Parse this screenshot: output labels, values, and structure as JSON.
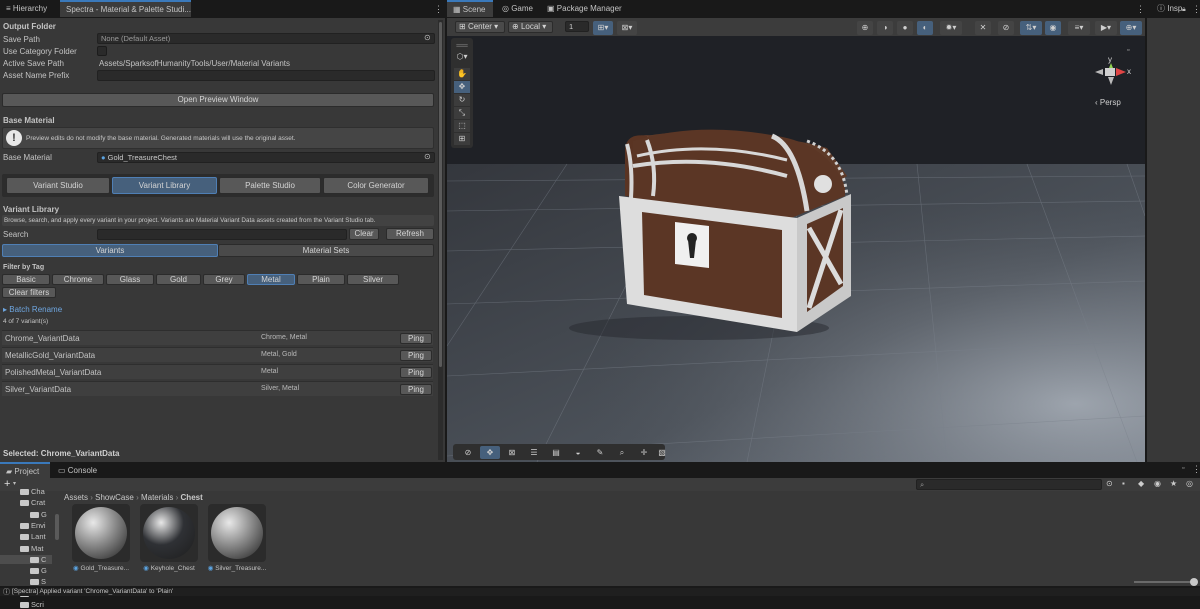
{
  "top_tabs": {
    "hierarchy": "Hierarchy",
    "spectra": "Spectra - Material & Palette Studi...",
    "scene": "Scene",
    "game": "Game",
    "package_manager": "Package Manager",
    "inspector": "Insp"
  },
  "output_folder": {
    "heading": "Output Folder",
    "save_path_label": "Save Path",
    "save_path_value": "None (Default Asset)",
    "use_category_label": "Use Category Folder",
    "active_save_label": "Active Save Path",
    "active_save_value": "Assets/SparksofHumanityTools/User/Material Variants",
    "prefix_label": "Asset Name Prefix",
    "prefix_value": ""
  },
  "open_preview_button": "Open Preview Window",
  "base_material": {
    "heading": "Base Material",
    "info": "Preview edits do not modify the base material. Generated materials will use the original asset.",
    "label": "Base Material",
    "value": "Gold_TreasureChest"
  },
  "studio_tabs": [
    "Variant Studio",
    "Variant Library",
    "Palette Studio",
    "Color Generator"
  ],
  "library": {
    "heading": "Variant Library",
    "description": "Browse, search, and apply every variant in your project. Variants are Material Variant Data assets created from the Variant Studio tab.",
    "search_label": "Search",
    "clear_button": "Clear",
    "refresh_button": "Refresh",
    "subtabs": [
      "Variants",
      "Material Sets"
    ],
    "filter_heading": "Filter by Tag",
    "tags": [
      "Basic",
      "Chrome",
      "Glass",
      "Gold",
      "Grey",
      "Metal",
      "Plain",
      "Silver"
    ],
    "clear_filters": "Clear filters",
    "batch_rename": "Batch Rename",
    "count": "4 of 7 variant(s)",
    "ping_label": "Ping",
    "variants": [
      {
        "name": "Chrome_VariantData",
        "tags": "Chrome, Metal"
      },
      {
        "name": "MetallicGold_VariantData",
        "tags": "Metal, Gold"
      },
      {
        "name": "PolishedMetal_VariantData",
        "tags": "Metal"
      },
      {
        "name": "Silver_VariantData",
        "tags": "Silver, Metal"
      }
    ],
    "selected": "Selected: Chrome_VariantData"
  },
  "scene_toolbar": {
    "pivot": "Center",
    "space": "Local",
    "snap_value": "1"
  },
  "gizmo": {
    "y": "y",
    "x": "x",
    "persp": "‹ Persp"
  },
  "bottom_tabs": {
    "project": "Project",
    "console": "Console"
  },
  "project": {
    "tree": [
      {
        "label": "Cha",
        "indent": 1
      },
      {
        "label": "Crat",
        "indent": 1
      },
      {
        "label": "G",
        "indent": 2
      },
      {
        "label": "Envi",
        "indent": 1
      },
      {
        "label": "Lant",
        "indent": 1
      },
      {
        "label": "Mat",
        "indent": 1
      },
      {
        "label": "C",
        "indent": 2
      },
      {
        "label": "G",
        "indent": 2
      },
      {
        "label": "S",
        "indent": 2
      },
      {
        "label": "Pref",
        "indent": 1
      },
      {
        "label": "Scri",
        "indent": 1
      }
    ],
    "breadcrumb": [
      "Assets",
      "ShowCase",
      "Materials",
      "Chest"
    ],
    "assets": [
      {
        "name": "Gold_Treasure...",
        "color": "#8a8a8a"
      },
      {
        "name": "Keyhole_Chest",
        "color": "#2f3135"
      },
      {
        "name": "Silver_Treasure...",
        "color": "#8c8c8c"
      }
    ]
  },
  "status_bar": "[Spectra] Applied variant 'Chrome_VariantData' to 'Plain'"
}
